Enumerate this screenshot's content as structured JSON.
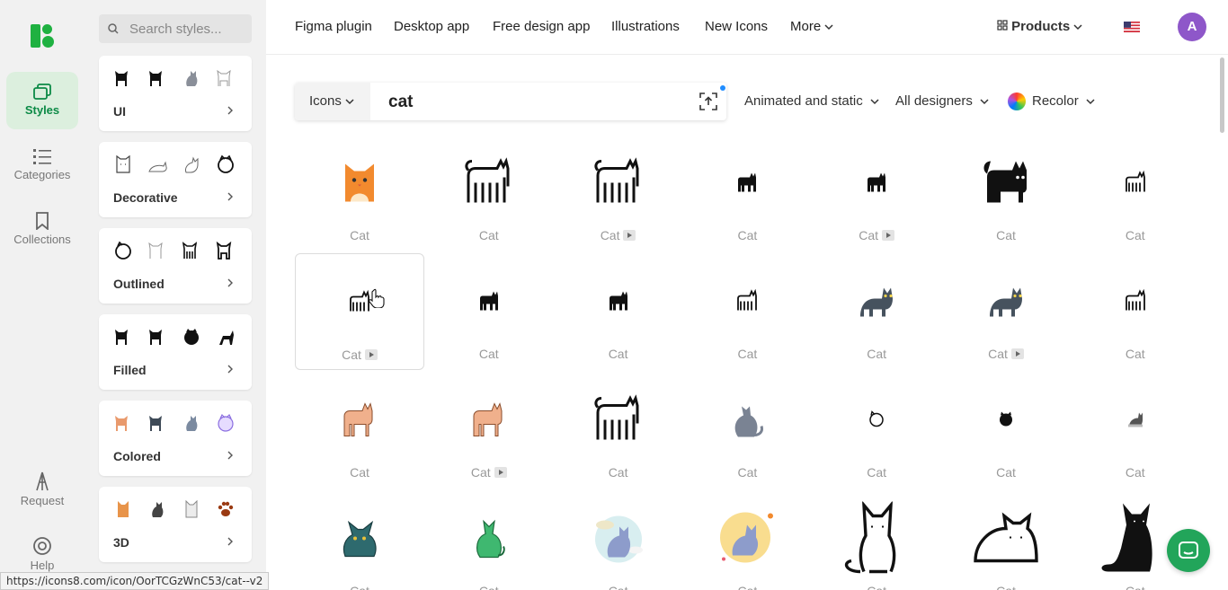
{
  "rail": {
    "items": [
      {
        "label": "Styles",
        "icon": "styles-icon"
      },
      {
        "label": "Categories",
        "icon": "categories-icon"
      },
      {
        "label": "Collections",
        "icon": "collections-icon"
      },
      {
        "label": "Request",
        "icon": "request-icon"
      },
      {
        "label": "Help",
        "icon": "help-icon"
      }
    ]
  },
  "stylepanel": {
    "search_placeholder": "Search styles...",
    "cards": [
      {
        "name": "UI"
      },
      {
        "name": "Decorative"
      },
      {
        "name": "Outlined"
      },
      {
        "name": "Filled"
      },
      {
        "name": "Colored"
      },
      {
        "name": "3D"
      }
    ]
  },
  "topnav": {
    "links": [
      "Figma plugin",
      "Desktop app",
      "Free design app",
      "Illustrations",
      "New Icons",
      "More"
    ],
    "products": "Products",
    "avatar_initial": "A"
  },
  "search": {
    "type": "Icons",
    "query": "cat"
  },
  "filters": {
    "animation": "Animated and static",
    "designers": "All designers",
    "recolor": "Recolor"
  },
  "results": {
    "rows": [
      [
        {
          "cap": "Cat",
          "anim": false,
          "kind": "colored-orange"
        },
        {
          "cap": "Cat",
          "anim": false,
          "kind": "outline-big"
        },
        {
          "cap": "Cat",
          "anim": true,
          "kind": "outline-big"
        },
        {
          "cap": "Cat",
          "anim": false,
          "kind": "small-black"
        },
        {
          "cap": "Cat",
          "anim": true,
          "kind": "small-black"
        },
        {
          "cap": "Cat",
          "anim": false,
          "kind": "big-black"
        },
        {
          "cap": "Cat",
          "anim": false,
          "kind": "small-outline"
        }
      ],
      [
        {
          "cap": "Cat",
          "anim": true,
          "kind": "small-outline"
        },
        {
          "cap": "Cat",
          "anim": false,
          "kind": "small-black"
        },
        {
          "cap": "Cat",
          "anim": false,
          "kind": "small-black"
        },
        {
          "cap": "Cat",
          "anim": false,
          "kind": "small-outline"
        },
        {
          "cap": "Cat",
          "anim": false,
          "kind": "dark-gray"
        },
        {
          "cap": "Cat",
          "anim": true,
          "kind": "dark-gray"
        },
        {
          "cap": "Cat",
          "anim": false,
          "kind": "small-outline"
        }
      ],
      [
        {
          "cap": "Cat",
          "anim": false,
          "kind": "peach"
        },
        {
          "cap": "Cat",
          "anim": true,
          "kind": "peach"
        },
        {
          "cap": "Cat",
          "anim": false,
          "kind": "outline-big"
        },
        {
          "cap": "Cat",
          "anim": false,
          "kind": "gray-sitting"
        },
        {
          "cap": "Cat",
          "anim": false,
          "kind": "tiny-outline"
        },
        {
          "cap": "Cat",
          "anim": false,
          "kind": "tiny-black"
        },
        {
          "cap": "Cat",
          "anim": false,
          "kind": "tiny-gray"
        }
      ],
      [
        {
          "cap": "Cat",
          "anim": false,
          "kind": "teal-angry"
        },
        {
          "cap": "Cat",
          "anim": false,
          "kind": "green-sitting"
        },
        {
          "cap": "Cat",
          "anim": false,
          "kind": "blue-cloud"
        },
        {
          "cap": "Cat",
          "anim": false,
          "kind": "yellow-circle"
        },
        {
          "cap": "Cat",
          "anim": false,
          "kind": "line-sitting"
        },
        {
          "cap": "Cat",
          "anim": false,
          "kind": "line-lying"
        },
        {
          "cap": "Cat",
          "anim": false,
          "kind": "black-sitting"
        }
      ]
    ]
  },
  "statusbar": "https://icons8.com/icon/OorTCGzWnC53/cat--v2",
  "colors": {
    "accent": "#0c8a46",
    "avatar": "#8e57c9",
    "chat": "#22a55a"
  }
}
